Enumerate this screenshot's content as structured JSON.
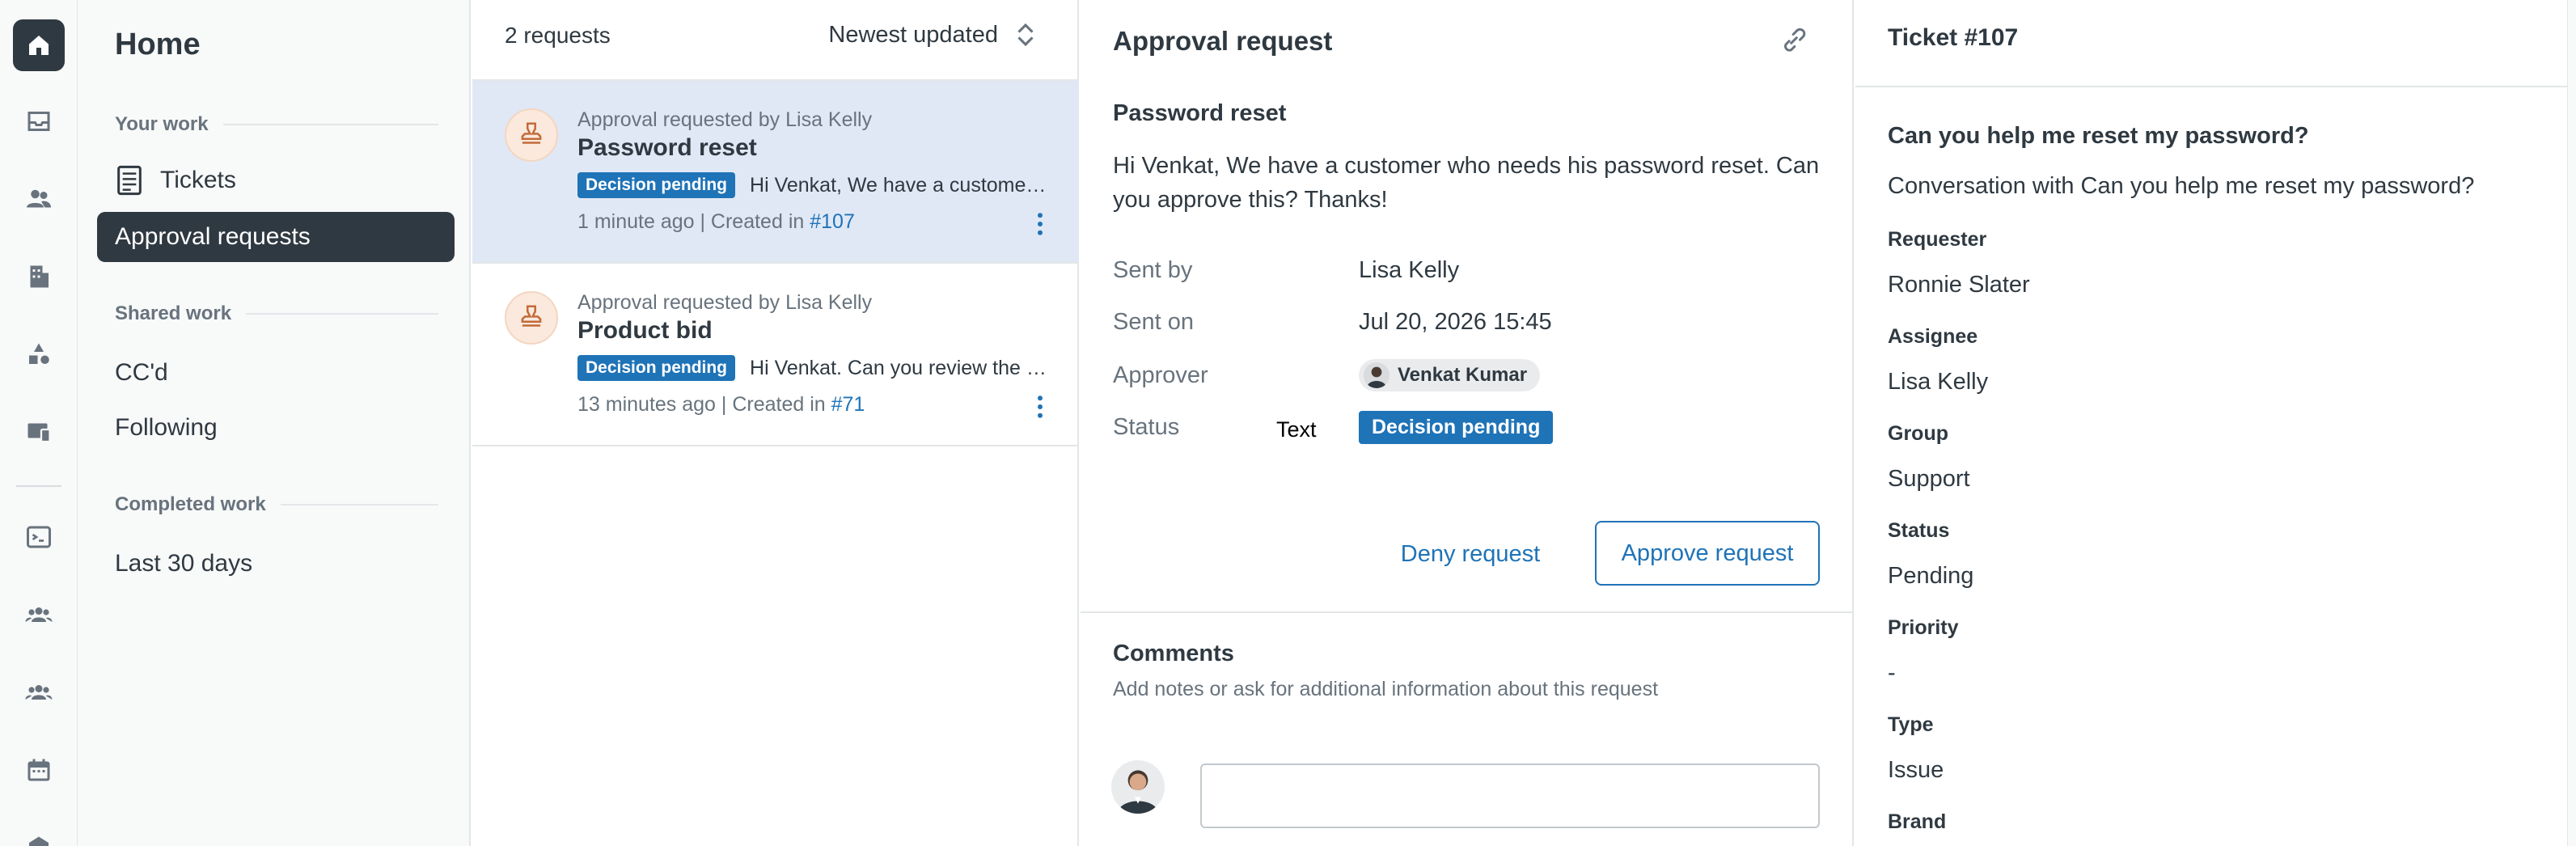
{
  "nav": {
    "title": "Home",
    "sections": {
      "your_work": "Your work",
      "shared_work": "Shared work",
      "completed_work": "Completed work"
    },
    "items": {
      "tickets": "Tickets",
      "approval_requests": "Approval requests",
      "ccd": "CC'd",
      "following": "Following",
      "last_30_days": "Last 30 days"
    }
  },
  "list": {
    "count": "2 requests",
    "sort": "Newest updated",
    "requests": [
      {
        "by": "Approval requested by Lisa Kelly",
        "title": "Password reset",
        "badge": "Decision pending",
        "snippet": "Hi Venkat, We have a customer who needs his password reset. Can you approve this? Thanks!",
        "meta": "1 minute ago | Created in ",
        "ticket": "#107"
      },
      {
        "by": "Approval requested by Lisa Kelly",
        "title": "Product bid",
        "badge": "Decision pending",
        "snippet": "Hi Venkat. Can you review the terms of this product bid?",
        "meta": "13 minutes ago | Created in ",
        "ticket": "#71"
      }
    ]
  },
  "detail": {
    "title": "Approval request",
    "subject": "Password reset",
    "body": "Hi Venkat, We have a customer who needs his password reset. Can you approve this? Thanks!",
    "sent_by_label": "Sent by",
    "sent_by": "Lisa Kelly",
    "sent_on_label": "Sent on",
    "sent_on": "Jul 20, 2026 15:45",
    "approver_label": "Approver",
    "approver": "Venkat Kumar",
    "status_label": "Status",
    "status_text_label": "Text",
    "status": "Decision pending",
    "deny": "Deny request",
    "approve": "Approve request",
    "comments_title": "Comments",
    "comments_hint": "Add notes or ask for additional information about this request"
  },
  "ticket": {
    "title": "Ticket #107",
    "subject": "Can you help me reset my password?",
    "conversation": "Conversation with Can you help me reset my password?",
    "requester_label": "Requester",
    "requester": "Ronnie Slater",
    "assignee_label": "Assignee",
    "assignee": "Lisa Kelly",
    "group_label": "Group",
    "group": "Support",
    "status_label": "Status",
    "status": "Pending",
    "priority_label": "Priority",
    "priority": "-",
    "type_label": "Type",
    "type": "Issue",
    "brand_label": "Brand"
  },
  "colors": {
    "accent": "#1f73b7",
    "dark": "#2f3941",
    "selected_row": "#e0e8f5"
  }
}
